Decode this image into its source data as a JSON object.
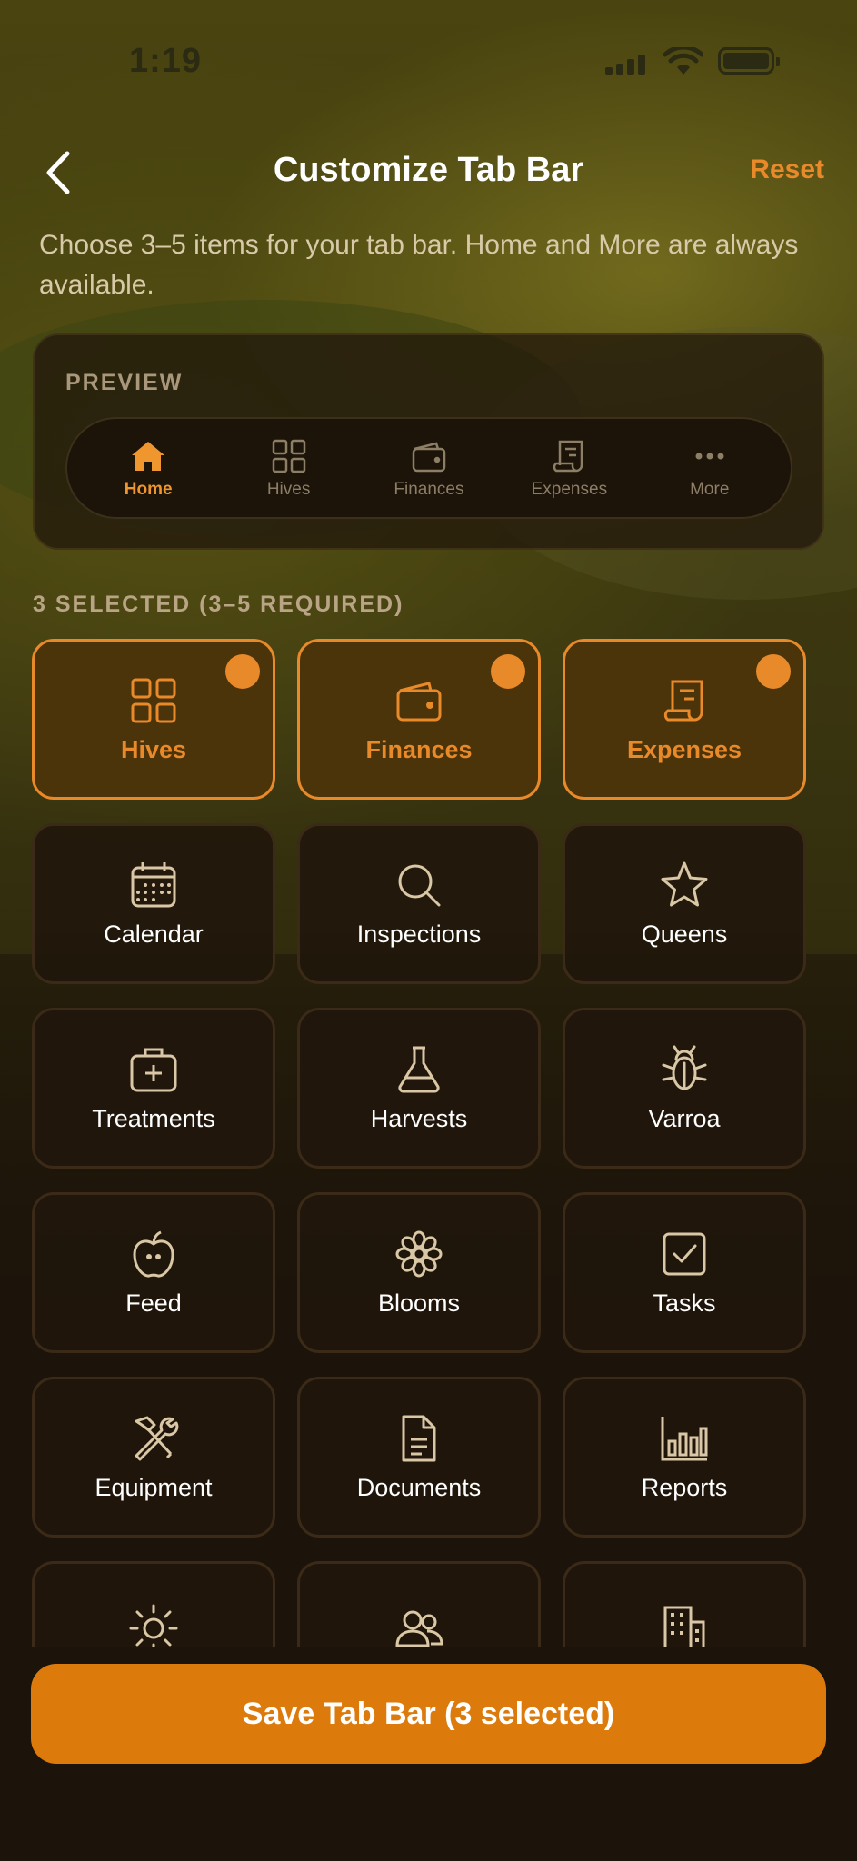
{
  "status_bar": {
    "time": "1:19"
  },
  "header": {
    "title": "Customize Tab Bar",
    "reset_label": "Reset"
  },
  "subtitle": "Choose 3–5 items for your tab bar. Home and More are always available.",
  "preview": {
    "label": "PREVIEW",
    "items": [
      {
        "label": "Home",
        "icon": "home-icon",
        "active": true
      },
      {
        "label": "Hives",
        "icon": "grid-icon",
        "active": false
      },
      {
        "label": "Finances",
        "icon": "wallet-icon",
        "active": false
      },
      {
        "label": "Expenses",
        "icon": "receipt-icon",
        "active": false
      },
      {
        "label": "More",
        "icon": "ellipsis-icon",
        "active": false
      }
    ]
  },
  "selection_label": "3 SELECTED (3–5 REQUIRED)",
  "tiles": [
    {
      "label": "Hives",
      "icon": "grid-icon",
      "selected": true
    },
    {
      "label": "Finances",
      "icon": "wallet-icon",
      "selected": true
    },
    {
      "label": "Expenses",
      "icon": "receipt-icon",
      "selected": true
    },
    {
      "label": "Calendar",
      "icon": "calendar-icon",
      "selected": false
    },
    {
      "label": "Inspections",
      "icon": "search-icon",
      "selected": false
    },
    {
      "label": "Queens",
      "icon": "star-icon",
      "selected": false
    },
    {
      "label": "Treatments",
      "icon": "medkit-icon",
      "selected": false
    },
    {
      "label": "Harvests",
      "icon": "flask-icon",
      "selected": false
    },
    {
      "label": "Varroa",
      "icon": "bug-icon",
      "selected": false
    },
    {
      "label": "Feed",
      "icon": "apple-icon",
      "selected": false
    },
    {
      "label": "Blooms",
      "icon": "flower-icon",
      "selected": false
    },
    {
      "label": "Tasks",
      "icon": "checkbox-icon",
      "selected": false
    },
    {
      "label": "Equipment",
      "icon": "tools-icon",
      "selected": false
    },
    {
      "label": "Documents",
      "icon": "document-icon",
      "selected": false
    },
    {
      "label": "Reports",
      "icon": "bar-chart-icon",
      "selected": false
    },
    {
      "label": "",
      "icon": "sun-icon",
      "selected": false
    },
    {
      "label": "",
      "icon": "people-icon",
      "selected": false
    },
    {
      "label": "",
      "icon": "building-icon",
      "selected": false
    }
  ],
  "save_button": {
    "label": "Save Tab Bar (3 selected)"
  },
  "colors": {
    "accent": "#e8892a",
    "button": "#dc7b0c",
    "background": "#1c130a"
  }
}
